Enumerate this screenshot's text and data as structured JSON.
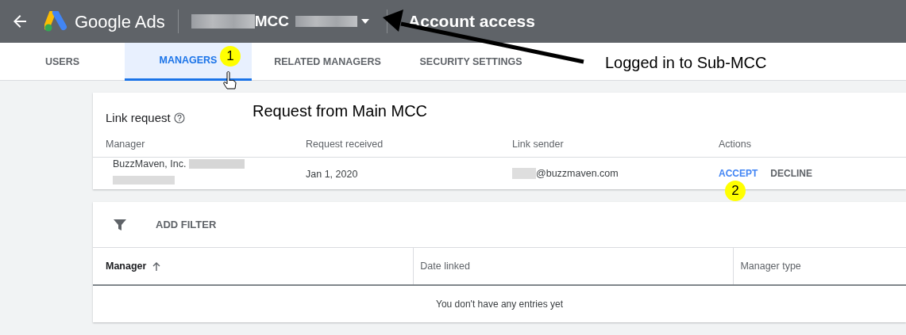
{
  "header": {
    "product": "Google Ads",
    "account": "MCC",
    "page_title": "Account access"
  },
  "tabs": [
    {
      "label": "USERS",
      "selected": false
    },
    {
      "label": "MANAGERS",
      "selected": true
    },
    {
      "label": "RELATED MANAGERS",
      "selected": false
    },
    {
      "label": "SECURITY SETTINGS",
      "selected": false
    }
  ],
  "link_request": {
    "title": "Link request",
    "columns": [
      "Manager",
      "Request received",
      "Link sender",
      "Actions"
    ],
    "rows": [
      {
        "manager": "BuzzMaven, Inc.",
        "received": "Jan 1, 2020",
        "sender": "@buzzmaven.com",
        "actions": [
          {
            "label": "ACCEPT",
            "kind": "primary"
          },
          {
            "label": "DECLINE",
            "kind": "plain"
          }
        ]
      }
    ]
  },
  "filter": {
    "label": "ADD FILTER"
  },
  "table": {
    "columns": [
      {
        "label": "Manager",
        "sorted": true
      },
      {
        "label": "Date linked",
        "sorted": false
      },
      {
        "label": "Manager type",
        "sorted": false
      }
    ],
    "empty_message": "You don't have any entries yet"
  },
  "annotations": {
    "steps": [
      "1",
      "2"
    ],
    "notes": [
      "Logged in to Sub-MCC",
      "Request from Main MCC"
    ]
  }
}
